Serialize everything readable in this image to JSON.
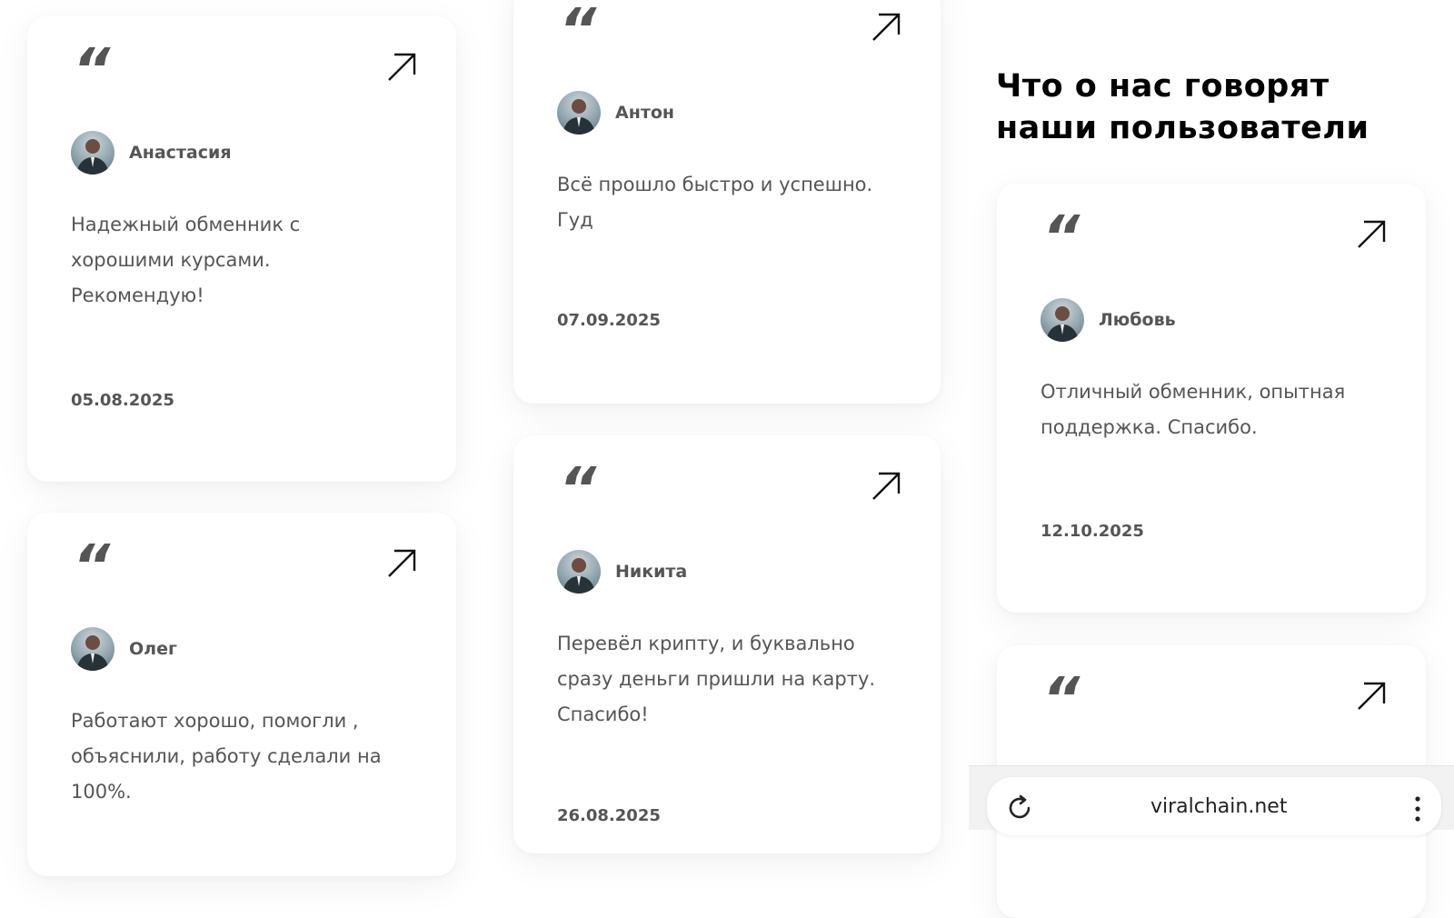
{
  "section": {
    "heading": "Что о нас говорят наши пользователи"
  },
  "reviews": [
    {
      "name": "Анастасия",
      "text": "Надежный обменник с хорошими курсами. Рекомендую!",
      "date": "05.08.2025"
    },
    {
      "name": "Олег",
      "text": "Работают хорошо, помогли , объяснили, работу сделали на 100%.",
      "date": ""
    },
    {
      "name": "Антон",
      "text": "Всё прошло быстро и успешно. Гуд",
      "date": "07.09.2025"
    },
    {
      "name": "Никита",
      "text": "Перевёл крипту, и буквально сразу деньги пришли на карту. Спасибо!",
      "date": "26.08.2025"
    },
    {
      "name": "Любовь",
      "text": "Отличный обменник, опытная поддержка. Спасибо.",
      "date": "12.10.2025"
    }
  ],
  "quote_mark": "“",
  "icons": {
    "open": "arrow-up-right-icon",
    "avatar": "user-avatar",
    "reload": "reload-icon",
    "menu": "more-vertical-icon"
  },
  "browser": {
    "url": "viralchain.net"
  },
  "colors": {
    "card_bg": "#ffffff",
    "text": "#555555",
    "heading": "#000000"
  }
}
